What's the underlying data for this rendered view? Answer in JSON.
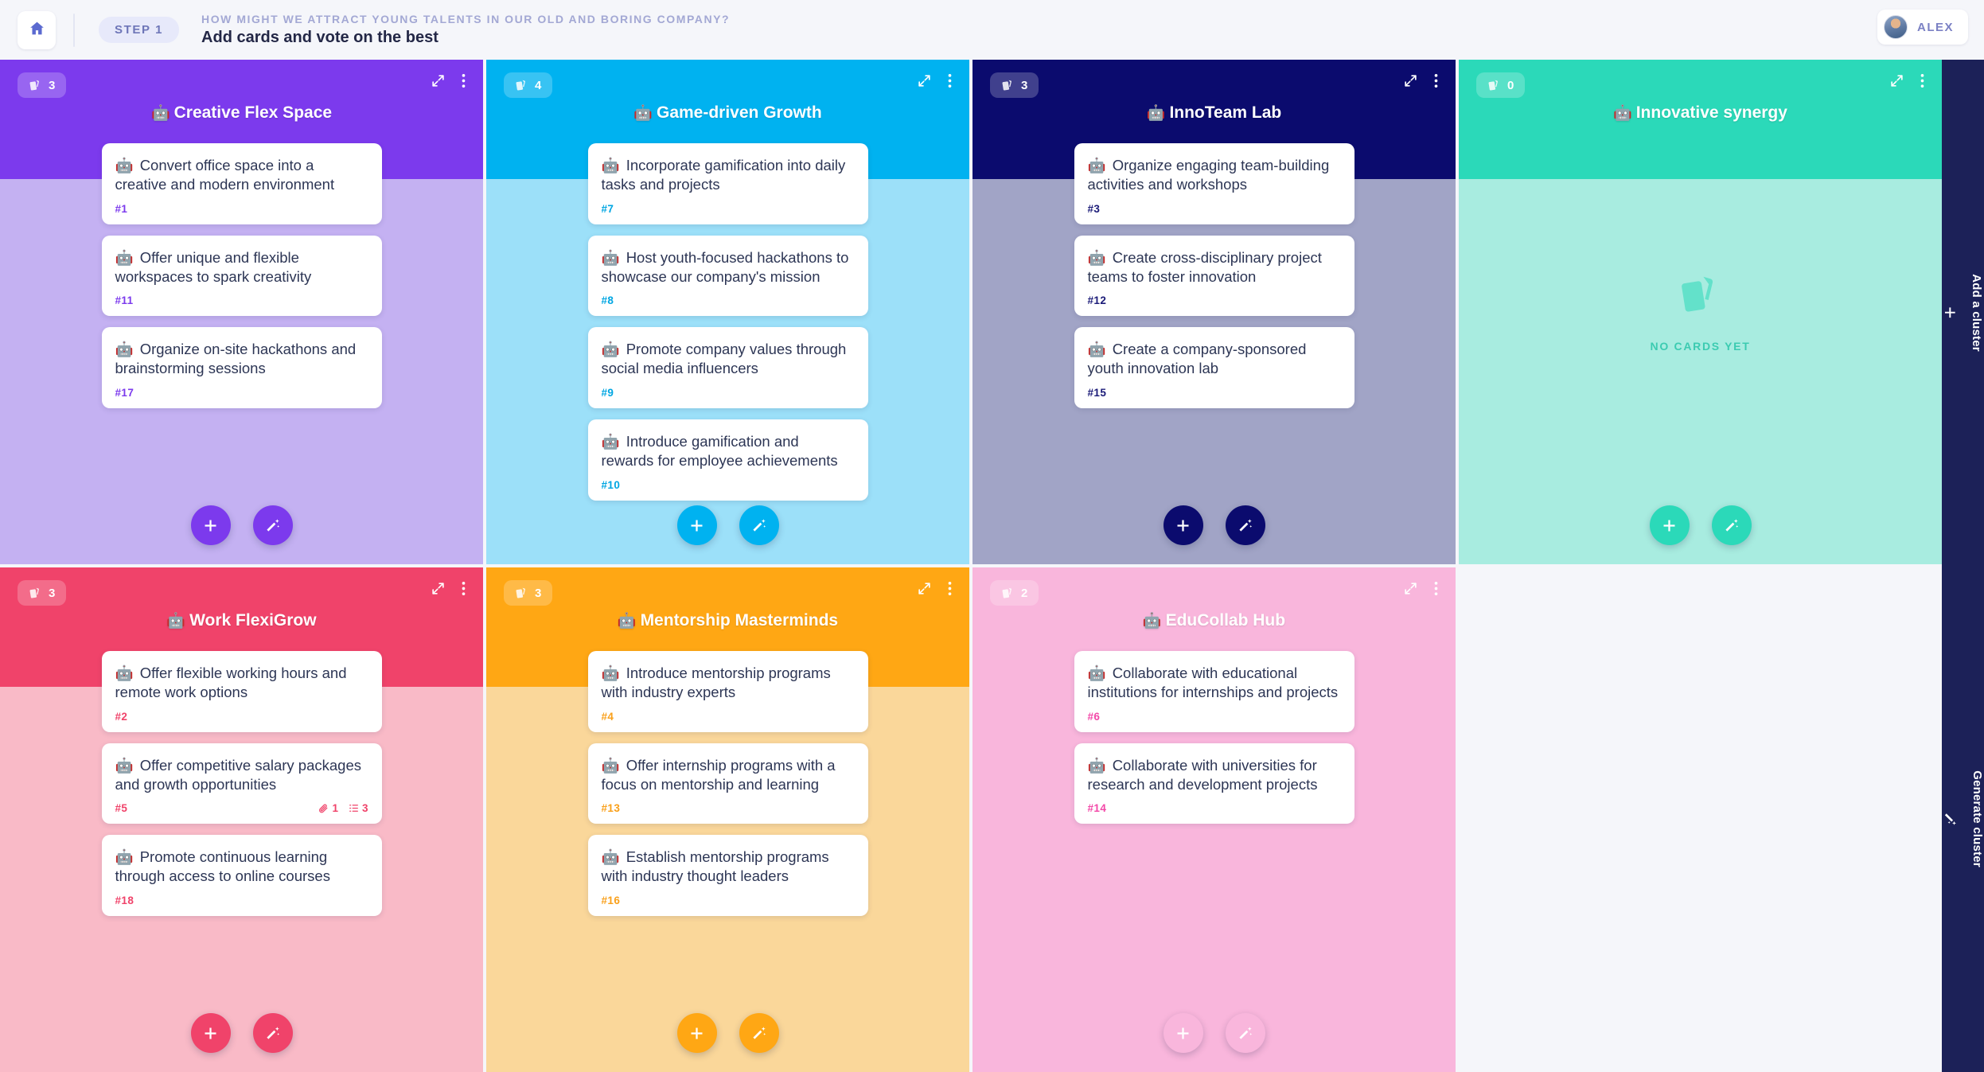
{
  "topbar": {
    "home_icon": "home-icon",
    "step_label": "STEP 1",
    "question": "HOW MIGHT WE ATTRACT YOUNG TALENTS IN OUR OLD AND BORING COMPANY?",
    "subtitle": "Add cards and vote on the best",
    "user_name": "ALEX"
  },
  "rail": {
    "add_cluster_label": "Add a cluster",
    "add_cluster_icon": "plus-icon",
    "generate_cluster_label": "Generate cluster",
    "generate_cluster_icon": "magic-wand-icon"
  },
  "common": {
    "bot_emoji": "🤖",
    "expand_icon": "expand-icon",
    "more_icon": "more-vertical-icon",
    "cards-stack_icon": "cards-stack-icon",
    "add_card_icon": "plus-icon",
    "generate_card_icon": "magic-wand-icon",
    "empty_label": "NO CARDS YET"
  },
  "clusters": [
    {
      "title": "Creative Flex Space",
      "count": "3",
      "color": "#7c3aed",
      "tint": "#c4b1f2",
      "id_color": "#7c3aed",
      "cards": [
        {
          "text": "Convert office space into a creative and modern environment",
          "id": "#1",
          "badges": []
        },
        {
          "text": "Offer unique and flexible workspaces to spark creativity",
          "id": "#11",
          "badges": []
        },
        {
          "text": "Organize on-site hackathons and brainstorming sessions",
          "id": "#17",
          "badges": []
        }
      ]
    },
    {
      "title": "Game-driven Growth",
      "count": "4",
      "color": "#00b2f0",
      "tint": "#9ce0f9",
      "id_color": "#00a6e2",
      "cards": [
        {
          "text": "Incorporate gamification into daily tasks and projects",
          "id": "#7",
          "badges": []
        },
        {
          "text": "Host youth-focused hackathons to showcase our company's mission",
          "id": "#8",
          "badges": []
        },
        {
          "text": "Promote company values through social media influencers",
          "id": "#9",
          "badges": []
        },
        {
          "text": "Introduce gamification and rewards for employee achievements",
          "id": "#10",
          "badges": []
        }
      ]
    },
    {
      "title": "InnoTeam Lab",
      "count": "3",
      "color": "#0b0b6e",
      "tint": "#a1a4c6",
      "id_color": "#1b1b78",
      "cards": [
        {
          "text": "Organize engaging team-building activities and workshops",
          "id": "#3",
          "badges": []
        },
        {
          "text": "Create cross-disciplinary project teams to foster innovation",
          "id": "#12",
          "badges": []
        },
        {
          "text": "Create a company-sponsored youth innovation lab",
          "id": "#15",
          "badges": []
        }
      ]
    },
    {
      "title": "Innovative synergy",
      "count": "0",
      "color": "#2bd9b9",
      "tint": "#a8ece0",
      "id_color": "#22c4a6",
      "cards": []
    },
    {
      "title": "Work FlexiGrow",
      "count": "3",
      "color": "#f0436a",
      "tint": "#f9bac7",
      "id_color": "#f0436a",
      "cards": [
        {
          "text": "Offer flexible working hours and remote work options",
          "id": "#2",
          "badges": []
        },
        {
          "text": "Offer competitive salary packages and growth opportunities",
          "id": "#5",
          "badges": [
            {
              "icon": "attachment-icon",
              "value": "1"
            },
            {
              "icon": "checklist-icon",
              "value": "3"
            }
          ]
        },
        {
          "text": "Promote continuous learning through access to online courses",
          "id": "#18",
          "badges": []
        }
      ]
    },
    {
      "title": "Mentorship Masterminds",
      "count": "3",
      "color": "#ffa714",
      "tint": "#fad79a",
      "id_color": "#f9a01b",
      "cards": [
        {
          "text": "Introduce mentorship programs with industry experts",
          "id": "#4",
          "badges": []
        },
        {
          "text": "Offer internship programs with a focus on mentorship and learning",
          "id": "#13",
          "badges": []
        },
        {
          "text": "Establish mentorship programs with industry thought leaders",
          "id": "#16",
          "badges": []
        }
      ]
    },
    {
      "title": "EduCollab Hub",
      "count": "2",
      "color": "#f council",
      "tint": "#f9b6dc",
      "id_color": "#f348a8",
      "cards": [
        {
          "text": "Collaborate with educational institutions for internships and projects",
          "id": "#6",
          "badges": []
        },
        {
          "text": "Collaborate with universities for research and development projects",
          "id": "#14",
          "badges": []
        }
      ]
    },
    {
      "title": "",
      "count": "",
      "color": "#f5f6fa",
      "tint": "#f5f6fa",
      "id_color": "#f5f6fa",
      "empty_slot": true,
      "cards": []
    }
  ]
}
